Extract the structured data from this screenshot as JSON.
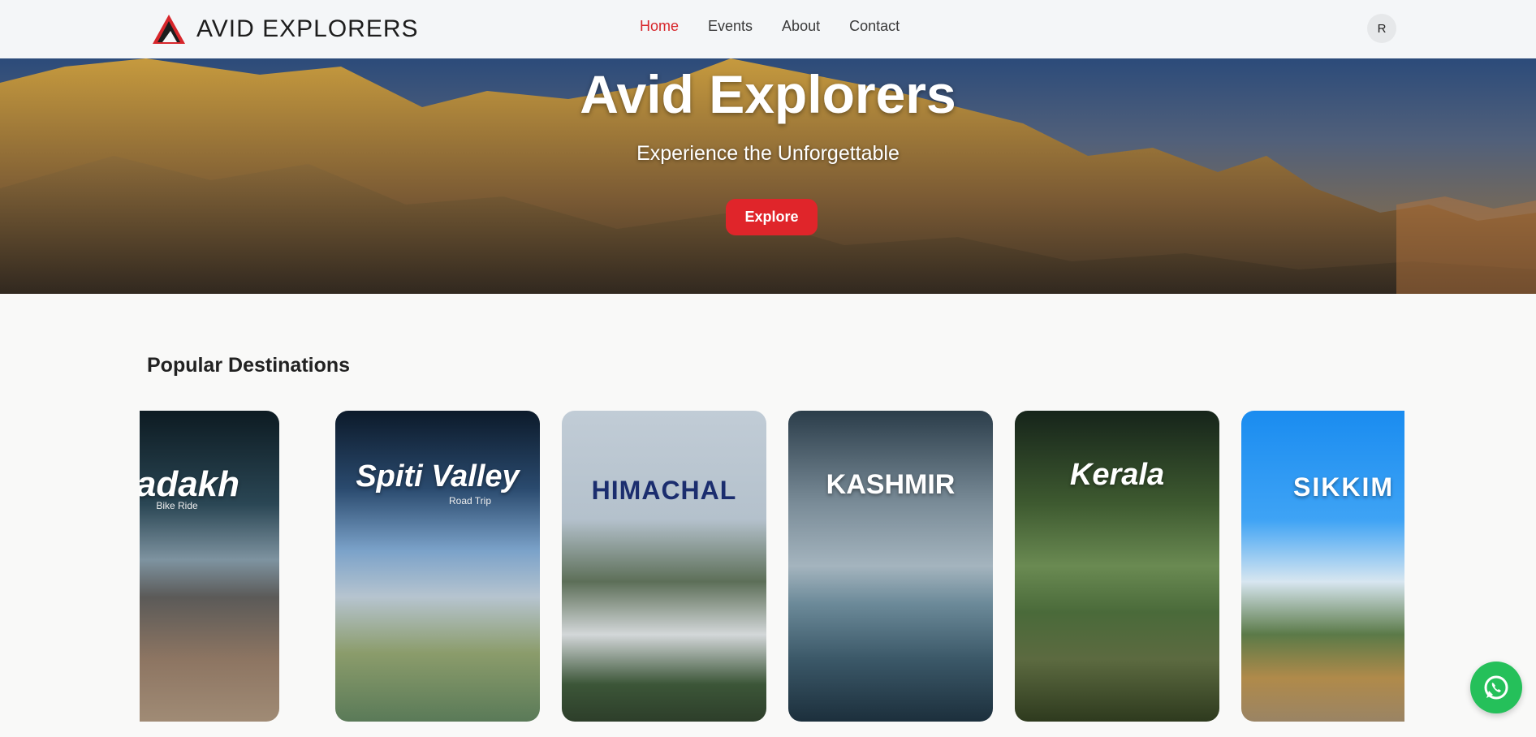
{
  "brand": {
    "name": "AVID EXPLORERS",
    "logo_icon": "mountain-logo-icon"
  },
  "nav": {
    "items": [
      {
        "label": "Home",
        "active": true
      },
      {
        "label": "Events",
        "active": false
      },
      {
        "label": "About",
        "active": false
      },
      {
        "label": "Contact",
        "active": false
      }
    ],
    "avatar_initial": "R"
  },
  "hero": {
    "title": "Avid Explorers",
    "subtitle": "Experience the Unforgettable",
    "cta_label": "Explore"
  },
  "destinations": {
    "heading": "Popular Destinations",
    "cards": [
      {
        "title": "Ladakh",
        "subtitle": "Bike Ride"
      },
      {
        "title": "Spiti Valley",
        "subtitle": "Road Trip"
      },
      {
        "title": "HIMACHAL",
        "subtitle": ""
      },
      {
        "title": "KASHMIR",
        "subtitle": ""
      },
      {
        "title": "Kerala",
        "subtitle": ""
      },
      {
        "title": "SIKKIM",
        "subtitle": ""
      }
    ]
  },
  "colors": {
    "accent": "#e0252a",
    "whatsapp": "#25c05a"
  },
  "floating": {
    "whatsapp_icon": "whatsapp-icon"
  }
}
